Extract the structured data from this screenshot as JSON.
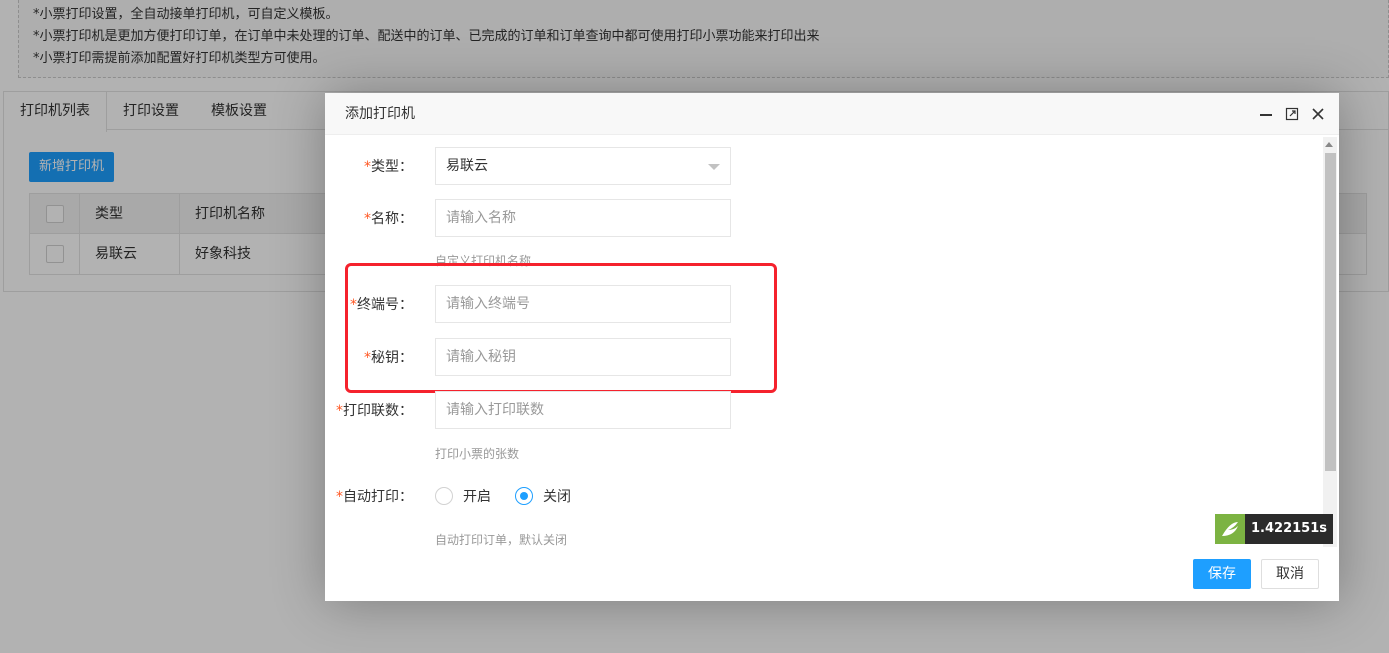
{
  "tips": [
    "*小票打印设置，全自动接单打印机，可自定义模板。",
    "*小票打印机是更加方便打印订单，在订单中未处理的订单、配送中的订单、已完成的订单和订单查询中都可使用打印小票功能来打印出来",
    "*小票打印需提前添加配置好打印机类型方可使用。"
  ],
  "tabs": [
    "打印机列表",
    "打印设置",
    "模板设置"
  ],
  "add_button": "新增打印机",
  "table": {
    "headers": [
      "类型",
      "打印机名称"
    ],
    "rows": [
      [
        "易联云",
        "好象科技"
      ]
    ]
  },
  "modal": {
    "title": "添加打印机",
    "fields": {
      "type": {
        "required": "*",
        "label": "类型：",
        "value": "易联云"
      },
      "name": {
        "required": "*",
        "label": "名称：",
        "placeholder": "请输入名称",
        "hint": "自定义打印机名称"
      },
      "terminal": {
        "required": "*",
        "label": "终端号：",
        "placeholder": "请输入终端号"
      },
      "secret": {
        "required": "*",
        "label": "秘钥：",
        "placeholder": "请输入秘钥"
      },
      "copies": {
        "required": "*",
        "label": "打印联数：",
        "placeholder": "请输入打印联数",
        "hint": "打印小票的张数"
      },
      "auto_print": {
        "required": "*",
        "label": "自动打印：",
        "options": [
          "开启",
          "关闭"
        ],
        "selected": "关闭",
        "hint": "自动打印订单，默认关闭"
      }
    },
    "save_label": "保存",
    "cancel_label": "取消"
  },
  "timer_value": "1.422151s",
  "colors": {
    "accent": "#1e9fff",
    "required": "#ff5722",
    "highlight": "#f5222d"
  }
}
